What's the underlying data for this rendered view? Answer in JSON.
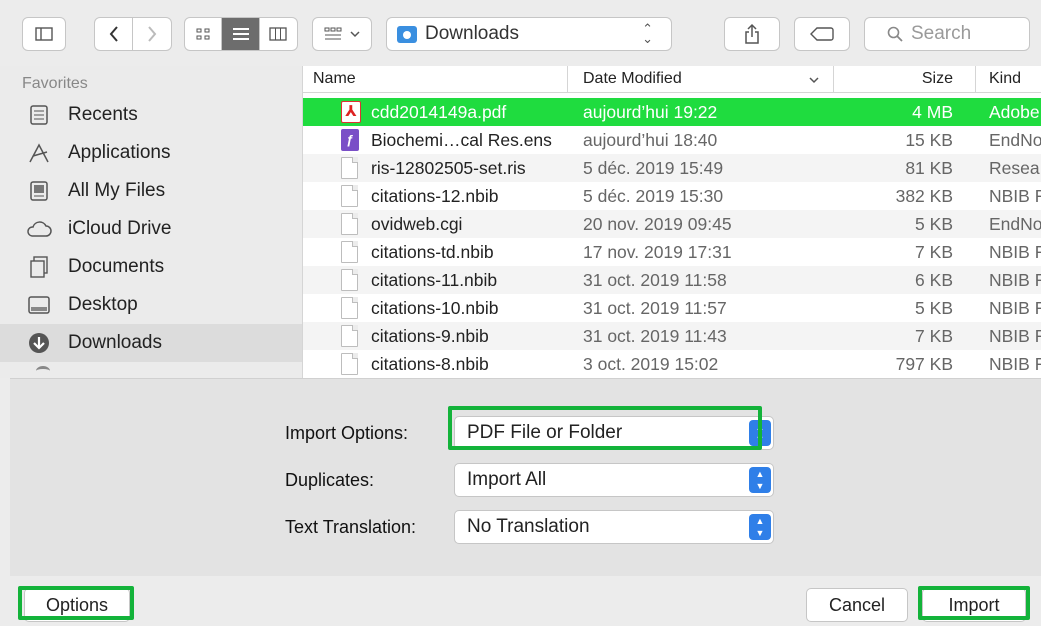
{
  "toolbar": {
    "location": "Downloads",
    "search_placeholder": "Search"
  },
  "sidebar": {
    "heading": "Favorites",
    "items": [
      {
        "label": "Recents",
        "icon": "recents-icon"
      },
      {
        "label": "Applications",
        "icon": "applications-icon"
      },
      {
        "label": "All My Files",
        "icon": "all-my-files-icon"
      },
      {
        "label": "iCloud Drive",
        "icon": "icloud-icon"
      },
      {
        "label": "Documents",
        "icon": "documents-icon"
      },
      {
        "label": "Desktop",
        "icon": "desktop-icon"
      },
      {
        "label": "Downloads",
        "icon": "downloads-icon",
        "selected": true
      }
    ]
  },
  "filelist": {
    "columns": {
      "name": "Name",
      "date": "Date Modified",
      "size": "Size",
      "kind": "Kind"
    },
    "rows": [
      {
        "icon": "pdf-icon",
        "name": "cdd2014149a.pdf",
        "date": "aujourd’hui 19:22",
        "size": "4 MB",
        "kind": "Adobe",
        "selected": true
      },
      {
        "icon": "endnote-icon",
        "name": "Biochemi…cal Res.ens",
        "date": "aujourd’hui 18:40",
        "size": "15 KB",
        "kind": "EndNo"
      },
      {
        "icon": "document-icon",
        "name": "ris-12802505-set.ris",
        "date": "5 déc. 2019 15:49",
        "size": "81 KB",
        "kind": "Resea"
      },
      {
        "icon": "document-icon",
        "name": "citations-12.nbib",
        "date": "5 déc. 2019 15:30",
        "size": "382 KB",
        "kind": "NBIB F"
      },
      {
        "icon": "document-icon",
        "name": "ovidweb.cgi",
        "date": "20 nov. 2019 09:45",
        "size": "5 KB",
        "kind": "EndNo"
      },
      {
        "icon": "document-icon",
        "name": "citations-td.nbib",
        "date": "17 nov. 2019 17:31",
        "size": "7 KB",
        "kind": "NBIB F"
      },
      {
        "icon": "document-icon",
        "name": "citations-11.nbib",
        "date": "31 oct. 2019 11:58",
        "size": "6 KB",
        "kind": "NBIB F"
      },
      {
        "icon": "document-icon",
        "name": "citations-10.nbib",
        "date": "31 oct. 2019 11:57",
        "size": "5 KB",
        "kind": "NBIB F"
      },
      {
        "icon": "document-icon",
        "name": "citations-9.nbib",
        "date": "31 oct. 2019 11:43",
        "size": "7 KB",
        "kind": "NBIB F"
      },
      {
        "icon": "document-icon",
        "name": "citations-8.nbib",
        "date": "3 oct. 2019 15:02",
        "size": "797 KB",
        "kind": "NBIB F"
      }
    ]
  },
  "options": {
    "import_options_label": "Import Options:",
    "import_options_value": "PDF File or Folder",
    "duplicates_label": "Duplicates:",
    "duplicates_value": "Import All",
    "text_translation_label": "Text Translation:",
    "text_translation_value": "No Translation"
  },
  "buttons": {
    "options": "Options",
    "cancel": "Cancel",
    "import": "Import"
  },
  "colors": {
    "selection": "#1fdc3f",
    "highlight": "#13b33a",
    "popup_stepper": "#2f7fe8"
  }
}
